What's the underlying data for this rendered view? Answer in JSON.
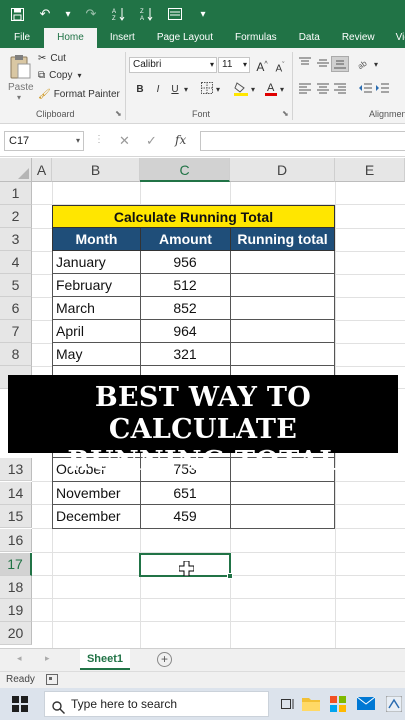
{
  "titlebar": {
    "save_icon": "save-icon",
    "undo_glyph": "↶",
    "dropdown_glyph": "▾",
    "redo_glyph": "↷"
  },
  "tabs": [
    "File",
    "Home",
    "Insert",
    "Page Layout",
    "Formulas",
    "Data",
    "Review",
    "View"
  ],
  "ribbon": {
    "paste": "Paste",
    "cut": "Cut",
    "copy": "Copy",
    "format_painter": "Format Painter",
    "clipboard_label": "Clipboard",
    "font_name": "Calibri",
    "font_size": "11",
    "grow": "A",
    "shrink": "A",
    "bold": "B",
    "italic": "I",
    "underline": "U",
    "font_label": "Font",
    "alignment_label": "Alignment"
  },
  "formula_bar": {
    "name_box": "C17",
    "fx": "fx",
    "value": ""
  },
  "columns": [
    "A",
    "B",
    "C",
    "D",
    "E"
  ],
  "rows": [
    "1",
    "2",
    "3",
    "4",
    "5",
    "6",
    "7",
    "8",
    "13",
    "14",
    "15",
    "16",
    "17",
    "18",
    "19",
    "20"
  ],
  "table": {
    "title": "Calculate Running Total",
    "headers": [
      "Month",
      "Amount",
      "Running total"
    ],
    "visible_rows": [
      {
        "month": "January",
        "amount": "956"
      },
      {
        "month": "February",
        "amount": "512"
      },
      {
        "month": "March",
        "amount": "852"
      },
      {
        "month": "April",
        "amount": "964"
      },
      {
        "month": "May",
        "amount": "321"
      },
      {
        "month": "October",
        "amount": "753"
      },
      {
        "month": "November",
        "amount": "651"
      },
      {
        "month": "December",
        "amount": "459"
      }
    ]
  },
  "banner": {
    "line1": "BEST WAY TO CALCULATE",
    "line2": "RUNNING TOTAL"
  },
  "sheets": {
    "active": "Sheet1",
    "add": "+"
  },
  "status": {
    "ready": "Ready"
  },
  "taskbar": {
    "search_placeholder": "Type here to search"
  },
  "colors": {
    "excel_green": "#217346",
    "title_fill": "#ffe600",
    "header_fill": "#1f4e79"
  }
}
